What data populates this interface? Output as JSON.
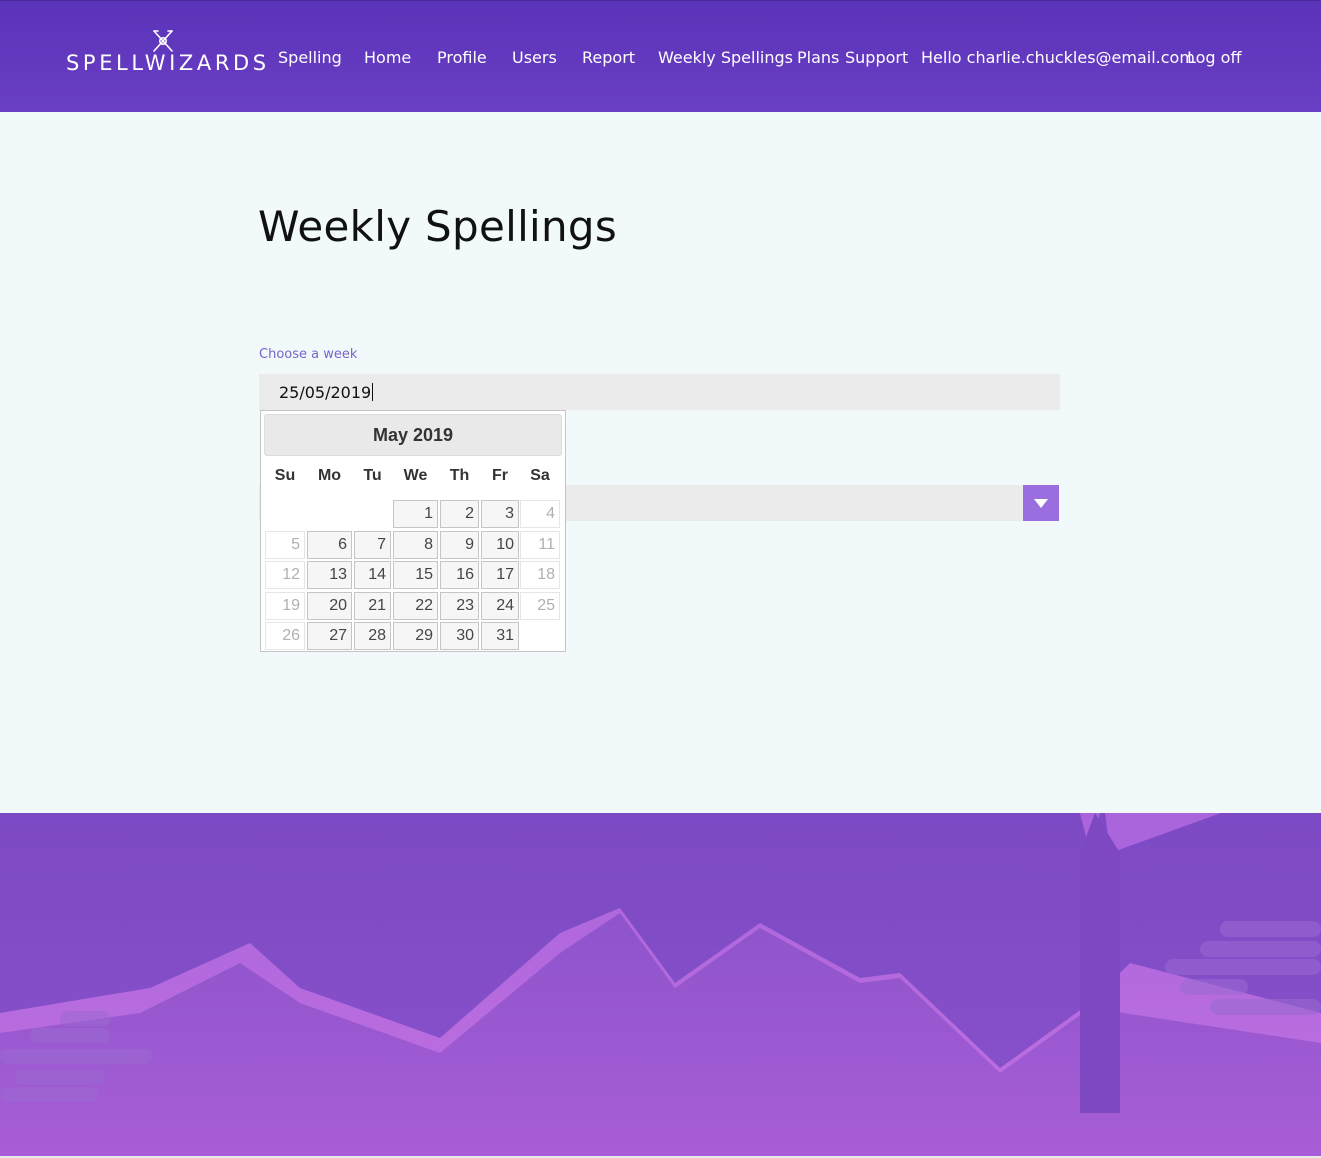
{
  "header": {
    "logo_text": "SPELLWIZARDS",
    "nav": [
      {
        "label": "Spelling"
      },
      {
        "label": "Home"
      },
      {
        "label": "Profile"
      },
      {
        "label": "Users"
      },
      {
        "label": "Report"
      },
      {
        "label": "Weekly Spellings"
      },
      {
        "label": "Plans"
      },
      {
        "label": "Support"
      },
      {
        "label": "Hello charlie.chuckles@email.com"
      },
      {
        "label": "Log off"
      }
    ]
  },
  "main": {
    "title": "Weekly Spellings",
    "week_label": "Choose a week",
    "week_value": "25/05/2019"
  },
  "datepicker": {
    "month_title": "May 2019",
    "weekdays": [
      "Su",
      "Mo",
      "Tu",
      "We",
      "Th",
      "Fr",
      "Sa"
    ],
    "weeks": [
      [
        null,
        null,
        null,
        "1",
        "2",
        "3",
        "4"
      ],
      [
        "5",
        "6",
        "7",
        "8",
        "9",
        "10",
        "11"
      ],
      [
        "12",
        "13",
        "14",
        "15",
        "16",
        "17",
        "18"
      ],
      [
        "19",
        "20",
        "21",
        "22",
        "23",
        "24",
        "25"
      ],
      [
        "26",
        "27",
        "28",
        "29",
        "30",
        "31",
        null
      ]
    ]
  },
  "colors": {
    "header": "#5a33b8",
    "accent": "#9b6ee0",
    "label": "#7a64c8",
    "page_bg": "#f1f9fb"
  },
  "icons": {
    "logo": "crossed-wands-icon",
    "select_arrow": "caret-down-icon"
  }
}
